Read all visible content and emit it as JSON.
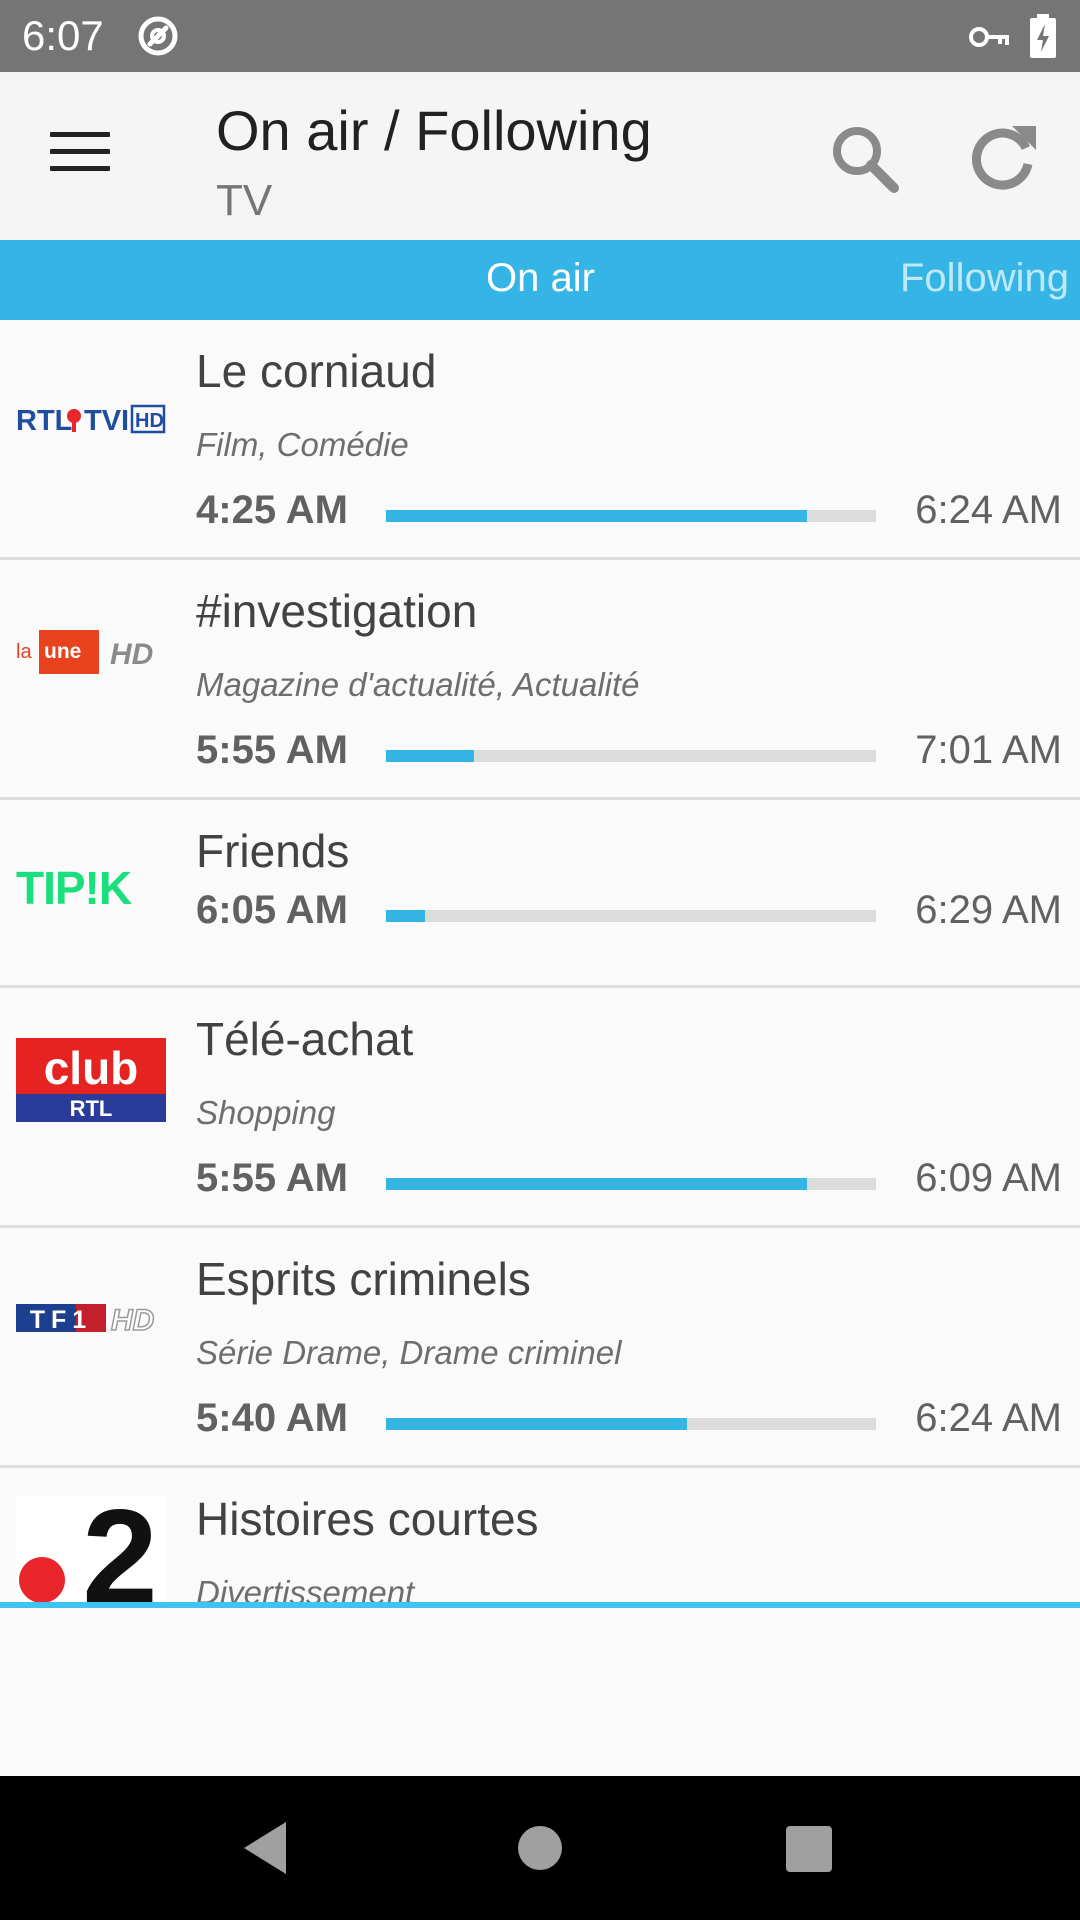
{
  "status_bar": {
    "time": "6:07"
  },
  "app_bar": {
    "title": "On air / Following",
    "subtitle": "TV"
  },
  "tabs": {
    "on_air": "On air",
    "following": "Following"
  },
  "programs": [
    {
      "channel": "RTL TVI HD",
      "title": "Le corniaud",
      "genre": "Film, Comédie",
      "start": "4:25 AM",
      "end": "6:24 AM",
      "progress": 0.86
    },
    {
      "channel": "La Une HD",
      "title": "#investigation",
      "genre": "Magazine d'actualité, Actualité",
      "start": "5:55 AM",
      "end": "7:01 AM",
      "progress": 0.18
    },
    {
      "channel": "Tipik",
      "title": "Friends",
      "genre": "",
      "start": "6:05 AM",
      "end": "6:29 AM",
      "progress": 0.08
    },
    {
      "channel": "Club RTL",
      "title": "Télé-achat",
      "genre": "Shopping",
      "start": "5:55 AM",
      "end": "6:09 AM",
      "progress": 0.86
    },
    {
      "channel": "TF1 HD",
      "title": "Esprits criminels",
      "genre": "Série Drame, Drame criminel",
      "start": "5:40 AM",
      "end": "6:24 AM",
      "progress": 0.615
    },
    {
      "channel": "France 2",
      "title": "Histoires courtes",
      "genre": "Divertissement"
    }
  ],
  "logos": {
    "rtl_left": "RTL",
    "rtl_right": "TVI",
    "rtl_hd": "HD",
    "laune_la": "la",
    "laune_une": "une",
    "laune_hd": "HD",
    "tipik": "TIP!K",
    "club": "club",
    "club_rtl": "RTL",
    "tf1": "TF1",
    "tf1_hd": "HD",
    "france2_num": "2"
  },
  "colors": {
    "accent": "#35b5e5",
    "status_bar": "#757575",
    "nav_bar": "#000000"
  }
}
